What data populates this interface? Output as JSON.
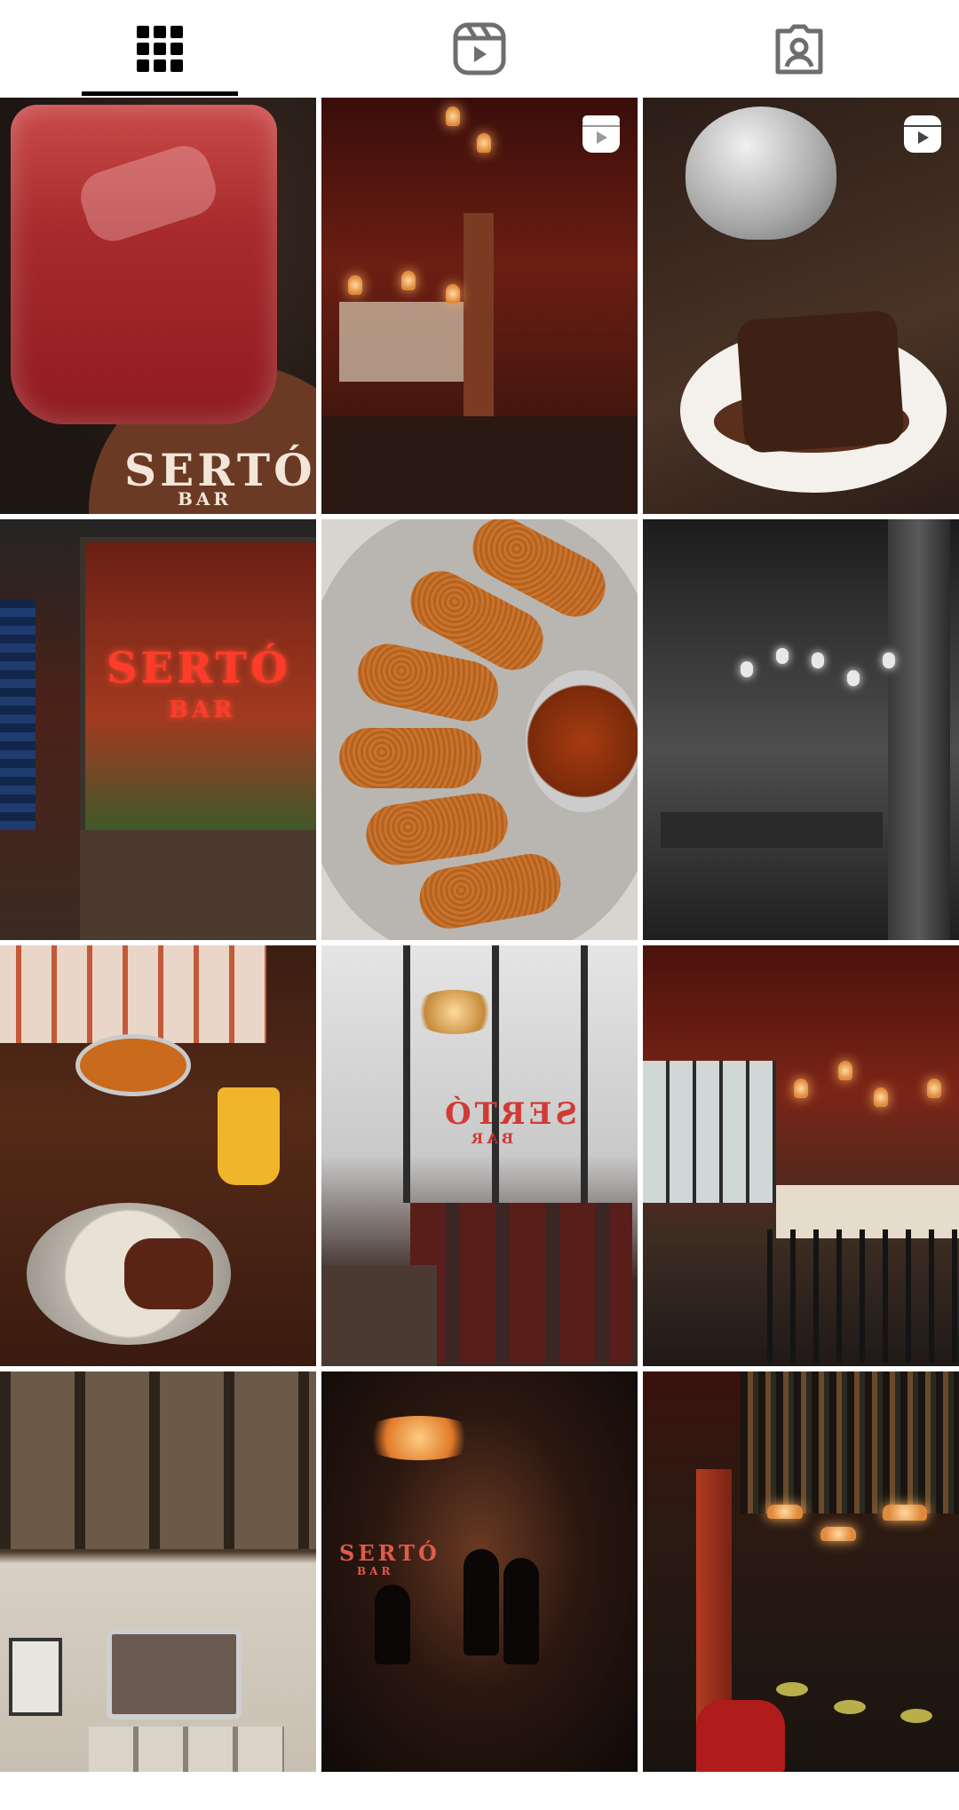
{
  "tabs": [
    {
      "name": "posts",
      "icon": "grid-icon",
      "active": true
    },
    {
      "name": "reels",
      "icon": "reels-icon",
      "active": false
    },
    {
      "name": "tagged",
      "icon": "tagged-person-icon",
      "active": false
    }
  ],
  "grid": {
    "columns": 3,
    "tiles": [
      {
        "subject": "red drink on coaster",
        "reel": false,
        "sign": "SERTÓ",
        "sign_sub": "BAR"
      },
      {
        "subject": "dark red restaurant interior",
        "reel": true
      },
      {
        "subject": "teapot pouring chocolate over cake",
        "reel": true
      },
      {
        "subject": "storefront with neon sign",
        "reel": false,
        "sign": "SERTÓ",
        "sign_sub": "BAR"
      },
      {
        "subject": "croquettes with dipping sauce",
        "reel": false
      },
      {
        "subject": "black and white dining room",
        "reel": false
      },
      {
        "subject": "table with dishes and drinks",
        "reel": false
      },
      {
        "subject": "bright dining room with window sign",
        "reel": false,
        "sign": "SERTÓ",
        "sign_sub": "BAR"
      },
      {
        "subject": "bar interior with hanging lamps",
        "reel": false
      },
      {
        "subject": "wall of photos and mirror",
        "reel": false
      },
      {
        "subject": "dark room with silhouettes",
        "reel": false,
        "sign": "SERTÓ",
        "sign_sub": "BAR"
      },
      {
        "subject": "bar counter with bottle shelves",
        "reel": false
      }
    ]
  },
  "colors": {
    "tab_active": "#000000",
    "tab_inactive": "#6e6e6e",
    "background": "#ffffff"
  }
}
